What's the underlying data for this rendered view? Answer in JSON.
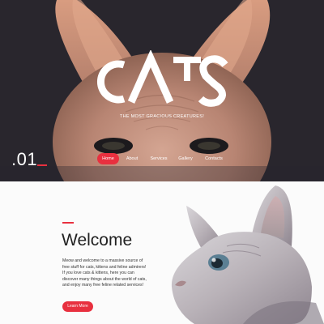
{
  "hero": {
    "logo_text": "CATS",
    "tagline": "THE MOST GRACIOUS CREATURES!",
    "slide_number": ".01"
  },
  "nav": {
    "items": [
      {
        "label": "Home",
        "active": true
      },
      {
        "label": "About",
        "active": false
      },
      {
        "label": "Services",
        "active": false
      },
      {
        "label": "Gallery",
        "active": false
      },
      {
        "label": "Contacts",
        "active": false
      }
    ]
  },
  "welcome": {
    "title": "Welcome",
    "body": "Meow and welcome to a massive source of free stuff for cats, kittens and feline admirers! If you love cats & kittens, here you can discover many things about the world of cats, and enjoy many free feline related services!",
    "button_label": "Learn More"
  },
  "colors": {
    "accent": "#e8303f",
    "hero_background": "#29262d",
    "welcome_background": "#fbfbfb"
  }
}
